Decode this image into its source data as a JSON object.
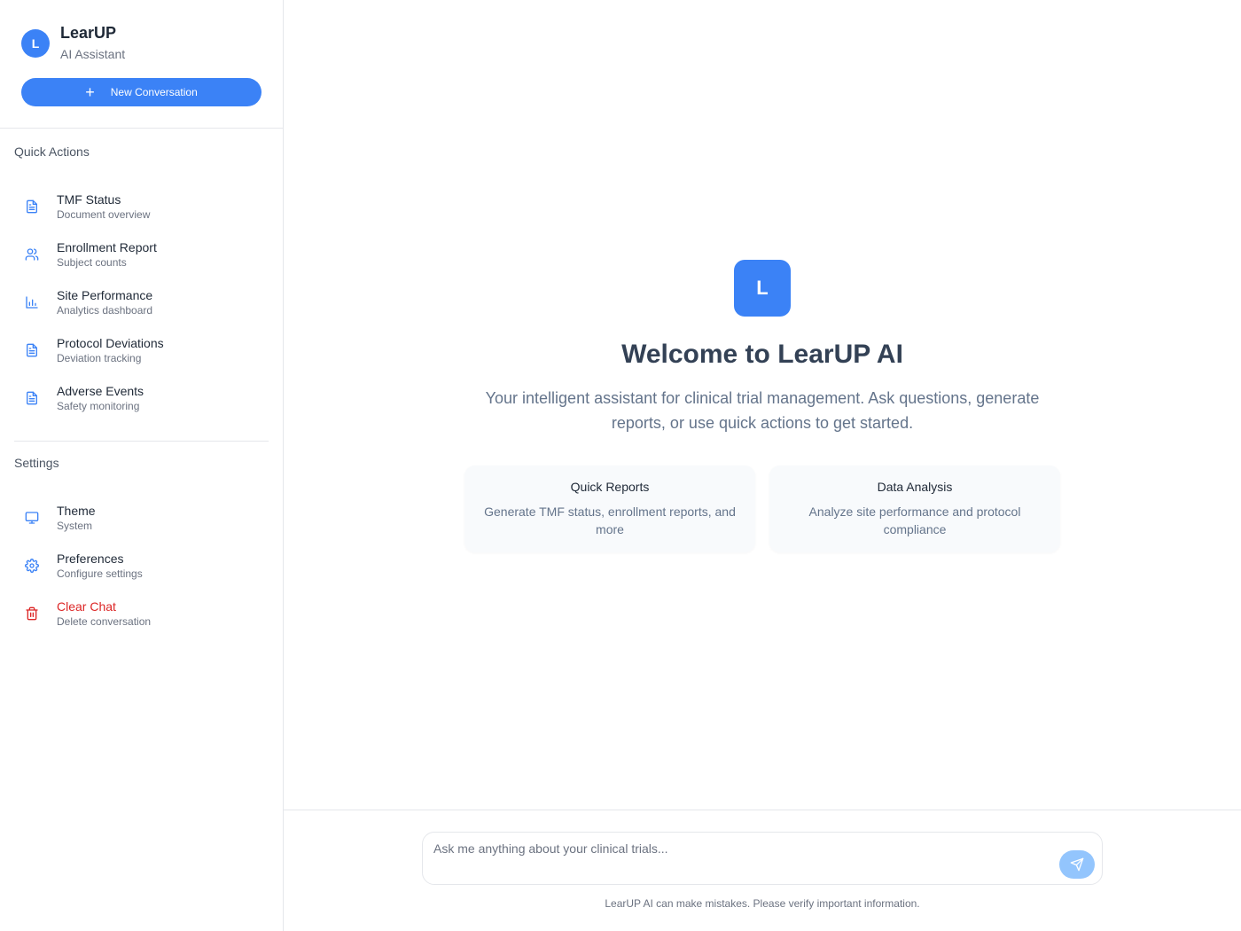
{
  "brand": {
    "avatar_letter": "L",
    "name": "LearUP",
    "subtitle": "AI Assistant"
  },
  "new_conversation_label": "New Conversation",
  "quick_actions": {
    "title": "Quick Actions",
    "items": [
      {
        "label": "TMF Status",
        "sub": "Document overview",
        "icon": "document-icon"
      },
      {
        "label": "Enrollment Report",
        "sub": "Subject counts",
        "icon": "users-icon"
      },
      {
        "label": "Site Performance",
        "sub": "Analytics dashboard",
        "icon": "bar-chart-icon"
      },
      {
        "label": "Protocol Deviations",
        "sub": "Deviation tracking",
        "icon": "document-icon"
      },
      {
        "label": "Adverse Events",
        "sub": "Safety monitoring",
        "icon": "document-icon"
      }
    ]
  },
  "settings": {
    "title": "Settings",
    "items": [
      {
        "label": "Theme",
        "sub": "System",
        "icon": "monitor-icon"
      },
      {
        "label": "Preferences",
        "sub": "Configure settings",
        "icon": "gear-icon"
      },
      {
        "label": "Clear Chat",
        "sub": "Delete conversation",
        "icon": "trash-icon"
      }
    ]
  },
  "welcome": {
    "logo_letter": "L",
    "title": "Welcome to LearUP AI",
    "description": "Your intelligent assistant for clinical trial management. Ask questions, generate reports, or use quick actions to get started.",
    "cards": [
      {
        "title": "Quick Reports",
        "desc": "Generate TMF status, enrollment reports, and more"
      },
      {
        "title": "Data Analysis",
        "desc": "Analyze site performance and protocol compliance"
      }
    ]
  },
  "chat": {
    "placeholder": "Ask me anything about your clinical trials...",
    "disclaimer": "LearUP AI can make mistakes. Please verify important information."
  },
  "colors": {
    "accent": "#3b82f6",
    "send_disabled": "#93c5fd",
    "danger": "#dc2626"
  }
}
